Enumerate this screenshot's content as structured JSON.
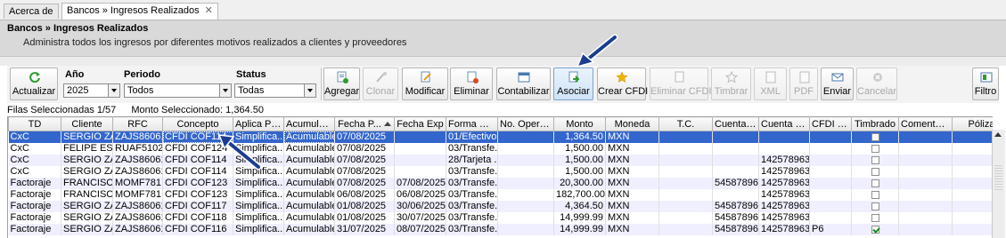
{
  "tabs": [
    {
      "label": "Acerca de",
      "active": false
    },
    {
      "label": "Bancos » Ingresos Realizados",
      "active": true
    }
  ],
  "tab_close_glyph": "✕",
  "header": {
    "title": "Bancos » Ingresos Realizados",
    "subtitle": "Administra todos los ingresos por diferentes motivos realizados a clientes y proveedores"
  },
  "toolbar": {
    "actualizar": "Actualizar",
    "anio_label": "Año",
    "anio_value": "2025",
    "periodo_label": "Periodo",
    "periodo_value": "Todos",
    "status_label": "Status",
    "status_value": "Todas",
    "agregar": "Agregar",
    "clonar": "Clonar",
    "modificar": "Modificar",
    "eliminar": "Eliminar",
    "contabilizar": "Contabilizar",
    "asociar": "Asociar",
    "crear_cfdi": "Crear CFDI",
    "eliminar_cfdi": "Eliminar CFDI",
    "timbrar": "Timbrar",
    "xml": "XML",
    "pdf": "PDF",
    "enviar": "Enviar",
    "cancelar": "Cancelar",
    "filtro": "Filtro"
  },
  "status": {
    "filas": "Filas Seleccionadas 1/57",
    "monto": "Monto Seleccionado: 1,364.50"
  },
  "columns": [
    "TD",
    "Cliente",
    "RFC",
    "Concepto",
    "Aplica Para",
    "Acumulable",
    "Fecha P...",
    "Fecha Exp",
    "Forma Pago",
    "No. Opera...",
    "Monto",
    "Moneda",
    "T.C.",
    "Cuenta E...",
    "Cuenta Re...",
    "CFDI Pago",
    "Timbrado",
    "Comentar...",
    "Póliza"
  ],
  "rows": [
    {
      "td": "CxC",
      "cliente": "SERGIO ZA...",
      "rfc": "ZAJS86061...",
      "concepto": "CFDI COF114",
      "aplica": "Simplifica...",
      "acumulable": "Acumulable",
      "fecha_p": "07/08/2025",
      "fecha_exp": "",
      "forma_pago": "01/Efectivo",
      "no_op": "",
      "monto": "1,364.50",
      "moneda": "MXN",
      "tc": "",
      "cuenta_e": "",
      "cuenta_r": "",
      "cfdi_pago": "",
      "timbrado": false,
      "comentario": "",
      "poliza": ""
    },
    {
      "td": "CxC",
      "cliente": "FELIPE ESP...",
      "rfc": "RUAF5102...",
      "concepto": "CFDI COF124",
      "aplica": "Simplifica...",
      "acumulable": "Acumulable",
      "fecha_p": "07/08/2025",
      "fecha_exp": "",
      "forma_pago": "03/Transfe...",
      "no_op": "",
      "monto": "1,500.00",
      "moneda": "MXN",
      "tc": "",
      "cuenta_e": "",
      "cuenta_r": "",
      "cfdi_pago": "",
      "timbrado": false,
      "comentario": "",
      "poliza": ""
    },
    {
      "td": "CxC",
      "cliente": "SERGIO ZA...",
      "rfc": "ZAJS86061...",
      "concepto": "CFDI COF114",
      "aplica": "Simplifica...",
      "acumulable": "Acumulable",
      "fecha_p": "07/08/2025",
      "fecha_exp": "",
      "forma_pago": "28/Tarjeta ...",
      "no_op": "",
      "monto": "1,500.00",
      "moneda": "MXN",
      "tc": "",
      "cuenta_e": "",
      "cuenta_r": "142578963...",
      "cfdi_pago": "",
      "timbrado": false,
      "comentario": "",
      "poliza": ""
    },
    {
      "td": "CxC",
      "cliente": "SERGIO ZA...",
      "rfc": "ZAJS86061...",
      "concepto": "CFDI COF114",
      "aplica": "Simplifica...",
      "acumulable": "Acumulable",
      "fecha_p": "07/08/2025",
      "fecha_exp": "",
      "forma_pago": "03/Transfe...",
      "no_op": "",
      "monto": "1,500.00",
      "moneda": "MXN",
      "tc": "",
      "cuenta_e": "",
      "cuenta_r": "142578963...",
      "cfdi_pago": "",
      "timbrado": false,
      "comentario": "",
      "poliza": ""
    },
    {
      "td": "Factoraje",
      "cliente": "FRANCISC...",
      "rfc": "MOMF781...",
      "concepto": "CFDI COF123",
      "aplica": "Simplifica...",
      "acumulable": "Acumulable",
      "fecha_p": "07/08/2025",
      "fecha_exp": "07/08/2025",
      "forma_pago": "03/Transfe...",
      "no_op": "",
      "monto": "20,300.00",
      "moneda": "MXN",
      "tc": "",
      "cuenta_e": "545878963...",
      "cuenta_r": "142578963...",
      "cfdi_pago": "",
      "timbrado": false,
      "comentario": "",
      "poliza": ""
    },
    {
      "td": "Factoraje",
      "cliente": "FRANCISC...",
      "rfc": "MOMF781...",
      "concepto": "CFDI COF123",
      "aplica": "Simplifica...",
      "acumulable": "Acumulable",
      "fecha_p": "06/08/2025",
      "fecha_exp": "06/08/2025",
      "forma_pago": "03/Transfe...",
      "no_op": "",
      "monto": "182,700.00",
      "moneda": "MXN",
      "tc": "",
      "cuenta_e": "",
      "cuenta_r": "142578963...",
      "cfdi_pago": "",
      "timbrado": false,
      "comentario": "",
      "poliza": ""
    },
    {
      "td": "Factoraje",
      "cliente": "SERGIO ZA...",
      "rfc": "ZAJS86061...",
      "concepto": "CFDI COF117",
      "aplica": "Simplifica...",
      "acumulable": "Acumulable",
      "fecha_p": "01/08/2025",
      "fecha_exp": "30/06/2025",
      "forma_pago": "03/Transfe...",
      "no_op": "",
      "monto": "4,364.50",
      "moneda": "MXN",
      "tc": "",
      "cuenta_e": "545878963...",
      "cuenta_r": "142578963...",
      "cfdi_pago": "",
      "timbrado": false,
      "comentario": "",
      "poliza": ""
    },
    {
      "td": "Factoraje",
      "cliente": "SERGIO ZA...",
      "rfc": "ZAJS86061...",
      "concepto": "CFDI COF118",
      "aplica": "Simplifica...",
      "acumulable": "Acumulable",
      "fecha_p": "01/08/2025",
      "fecha_exp": "30/07/2025",
      "forma_pago": "03/Transfe...",
      "no_op": "",
      "monto": "14,999.99",
      "moneda": "MXN",
      "tc": "",
      "cuenta_e": "545878963...",
      "cuenta_r": "142578963...",
      "cfdi_pago": "",
      "timbrado": false,
      "comentario": "",
      "poliza": ""
    },
    {
      "td": "Factoraje",
      "cliente": "SERGIO ZA...",
      "rfc": "ZAJS86061...",
      "concepto": "CFDI COF116",
      "aplica": "Simplifica...",
      "acumulable": "Acumulable",
      "fecha_p": "31/07/2025",
      "fecha_exp": "08/07/2025",
      "forma_pago": "03/Transfe...",
      "no_op": "",
      "monto": "14,999.99",
      "moneda": "MXN",
      "tc": "",
      "cuenta_e": "545878963...",
      "cuenta_r": "142578963...",
      "cfdi_pago": "P6",
      "timbrado": true,
      "comentario": "",
      "poliza": ""
    }
  ],
  "colors": {
    "selection": "#3366cc",
    "alt_row": "#efefff",
    "arrow": "#1a3d8f"
  },
  "icons": [
    "refresh-icon",
    "add-icon",
    "clone-icon",
    "edit-icon",
    "delete-icon",
    "accounting-icon",
    "associate-icon",
    "star-icon",
    "send-icon",
    "cancel-icon",
    "filter-icon"
  ]
}
